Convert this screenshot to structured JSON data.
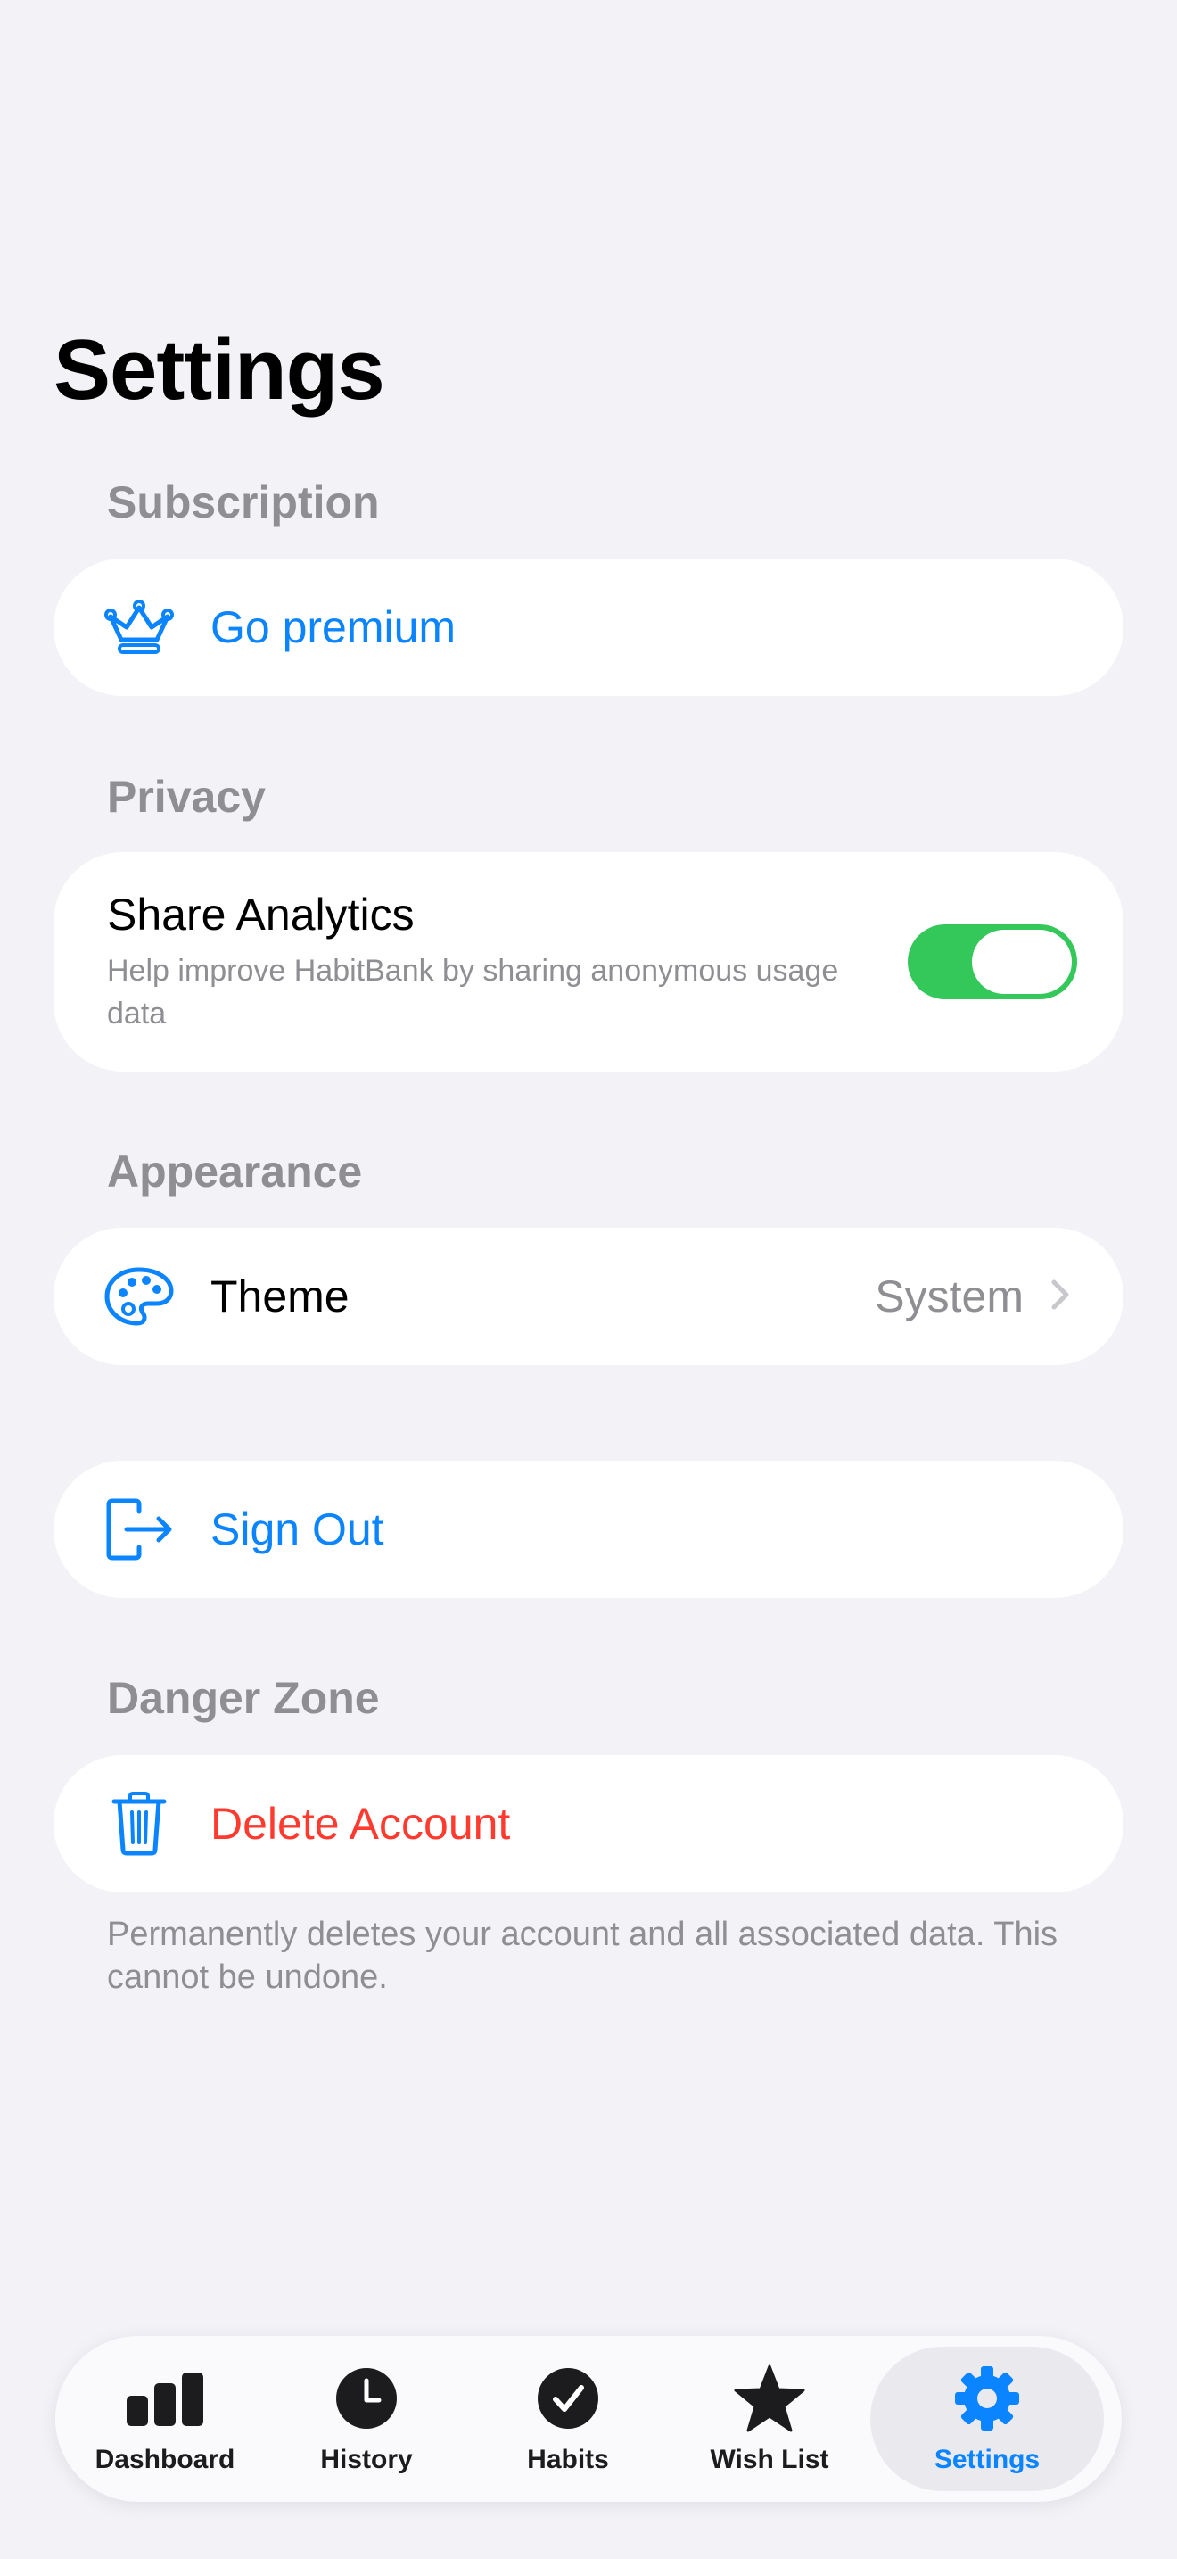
{
  "page": {
    "title": "Settings"
  },
  "sections": {
    "subscription": {
      "header": "Subscription",
      "go_premium_label": "Go premium"
    },
    "privacy": {
      "header": "Privacy",
      "share_analytics_title": "Share Analytics",
      "share_analytics_subtitle": "Help improve HabitBank by sharing anonymous usage data",
      "share_analytics_enabled": true
    },
    "appearance": {
      "header": "Appearance",
      "theme_label": "Theme",
      "theme_value": "System"
    },
    "account": {
      "sign_out_label": "Sign Out"
    },
    "danger": {
      "header": "Danger Zone",
      "delete_label": "Delete Account",
      "footnote": "Permanently deletes your account and all associated data. This cannot be undone."
    }
  },
  "tabbar": {
    "items": [
      {
        "label": "Dashboard",
        "icon": "chart-bars-icon"
      },
      {
        "label": "History",
        "icon": "clock-icon"
      },
      {
        "label": "Habits",
        "icon": "checkmark-circle-icon"
      },
      {
        "label": "Wish List",
        "icon": "star-icon"
      },
      {
        "label": "Settings",
        "icon": "gear-icon"
      }
    ],
    "active": "Settings"
  },
  "colors": {
    "accent": "#0a84ff",
    "destructive": "#ff3b30",
    "toggle_on": "#34c759",
    "secondary_text": "#8e8e93",
    "background": "#f2f2f7"
  }
}
